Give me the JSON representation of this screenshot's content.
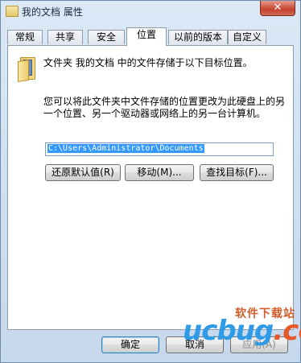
{
  "window": {
    "title": "我的文档 属性",
    "close_glyph": "✕"
  },
  "tabs": [
    {
      "label": "常规"
    },
    {
      "label": "共享"
    },
    {
      "label": "安全"
    },
    {
      "label": "位置",
      "active": true
    },
    {
      "label": "以前的版本"
    },
    {
      "label": "自定义"
    }
  ],
  "location": {
    "target_description": "文件夹 我的文档 中的文件存储于以下目标位置。",
    "move_description": "您可以将此文件夹中文件存储的位置更改为此硬盘上的另一个位置、另一个驱动器或网络上的另一台计算机。",
    "path_value": "C:\\Users\\Administrator\\Documents",
    "restore_default_label": "还原默认值(R)",
    "move_label": "移动(M)...",
    "find_target_label": "查找目标(F)..."
  },
  "footer": {
    "ok_label": "确定",
    "cancel_label": "取消",
    "apply_label": "应用(A)"
  },
  "watermark": {
    "site": "软件下载站",
    "logo": "ucbug",
    "logo_suffix": ".cc"
  },
  "colors": {
    "selection": "#3399ff",
    "panel": "#ffffff",
    "frame": "#cfdff0",
    "close": "#c3432c"
  },
  "icons": [
    "folder-icon",
    "close-icon"
  ]
}
